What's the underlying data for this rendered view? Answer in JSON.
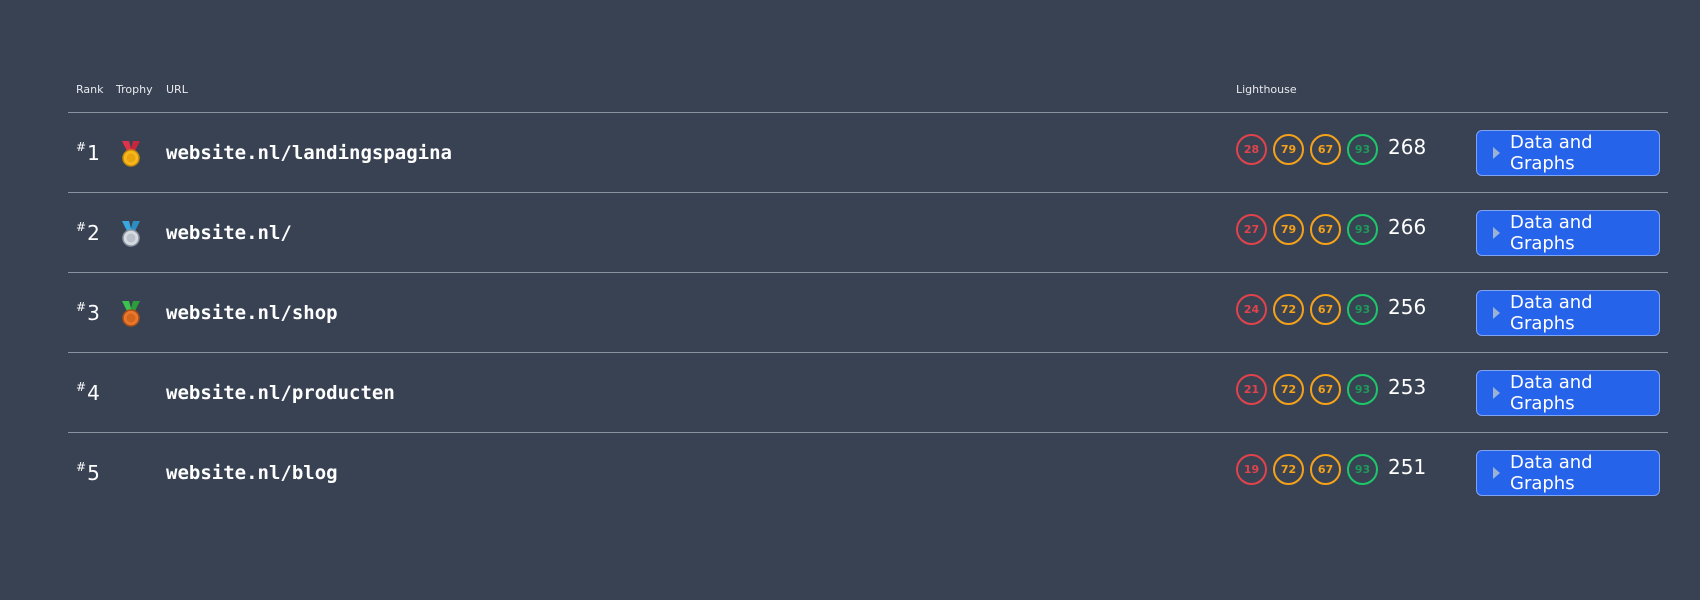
{
  "header": {
    "rank": "Rank",
    "trophy": "Trophy",
    "url": "URL",
    "lighthouse": "Lighthouse"
  },
  "colors": {
    "background": "#394253",
    "button": "#2563eb",
    "score_red": "#e2434b",
    "score_orange": "#f5a21a",
    "score_green": "#1cc86a"
  },
  "rows": [
    {
      "hash": "#",
      "rank": "1",
      "trophy": "gold-medal-icon",
      "url": "website.nl/landingspagina",
      "scores": [
        "28",
        "79",
        "67",
        "93"
      ],
      "total": "268",
      "button": "Data and Graphs"
    },
    {
      "hash": "#",
      "rank": "2",
      "trophy": "silver-medal-icon",
      "url": "website.nl/",
      "scores": [
        "27",
        "79",
        "67",
        "93"
      ],
      "total": "266",
      "button": "Data and Graphs"
    },
    {
      "hash": "#",
      "rank": "3",
      "trophy": "bronze-medal-icon",
      "url": "website.nl/shop",
      "scores": [
        "24",
        "72",
        "67",
        "93"
      ],
      "total": "256",
      "button": "Data and Graphs"
    },
    {
      "hash": "#",
      "rank": "4",
      "trophy": "",
      "url": "website.nl/producten",
      "scores": [
        "21",
        "72",
        "67",
        "93"
      ],
      "total": "253",
      "button": "Data and Graphs"
    },
    {
      "hash": "#",
      "rank": "5",
      "trophy": "",
      "url": "website.nl/blog",
      "scores": [
        "19",
        "72",
        "67",
        "93"
      ],
      "total": "251",
      "button": "Data and Graphs"
    }
  ]
}
